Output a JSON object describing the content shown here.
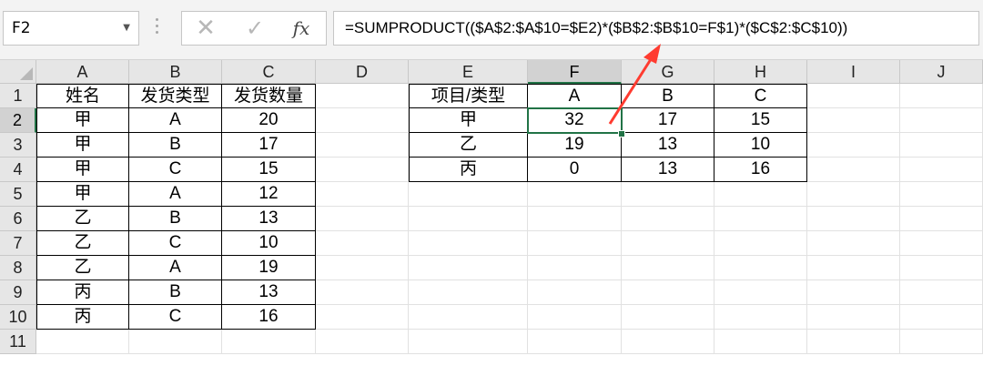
{
  "formula_bar": {
    "name_box": "F2",
    "name_box_dropdown_icon": "chevron-down-icon",
    "cancel_icon": "✕",
    "enter_icon": "✓",
    "fx_label": "fx",
    "formula": "=SUMPRODUCT(($A$2:$A$10=$E2)*($B$2:$B$10=F$1)*($C$2:$C$10))"
  },
  "selected": {
    "column": "F",
    "row": "2",
    "cell": "F2"
  },
  "columns": [
    "A",
    "B",
    "C",
    "D",
    "E",
    "F",
    "G",
    "H",
    "I",
    "J"
  ],
  "rows": [
    "1",
    "2",
    "3",
    "4",
    "5",
    "6",
    "7",
    "8",
    "9",
    "10",
    "11"
  ],
  "source_table": {
    "headers": [
      "姓名",
      "发货类型",
      "发货数量"
    ],
    "rows": [
      [
        "甲",
        "A",
        "20"
      ],
      [
        "甲",
        "B",
        "17"
      ],
      [
        "甲",
        "C",
        "15"
      ],
      [
        "甲",
        "A",
        "12"
      ],
      [
        "乙",
        "B",
        "13"
      ],
      [
        "乙",
        "C",
        "10"
      ],
      [
        "乙",
        "A",
        "19"
      ],
      [
        "丙",
        "B",
        "13"
      ],
      [
        "丙",
        "C",
        "16"
      ]
    ]
  },
  "summary_table": {
    "corner_header": "项目/类型",
    "headers": [
      "A",
      "B",
      "C"
    ],
    "rows": [
      {
        "name": "甲",
        "values": [
          "32",
          "17",
          "15"
        ]
      },
      {
        "name": "乙",
        "values": [
          "19",
          "13",
          "10"
        ]
      },
      {
        "name": "丙",
        "values": [
          "0",
          "13",
          "16"
        ]
      }
    ]
  },
  "annotation": {
    "type": "arrow",
    "color": "#ff3b30"
  }
}
